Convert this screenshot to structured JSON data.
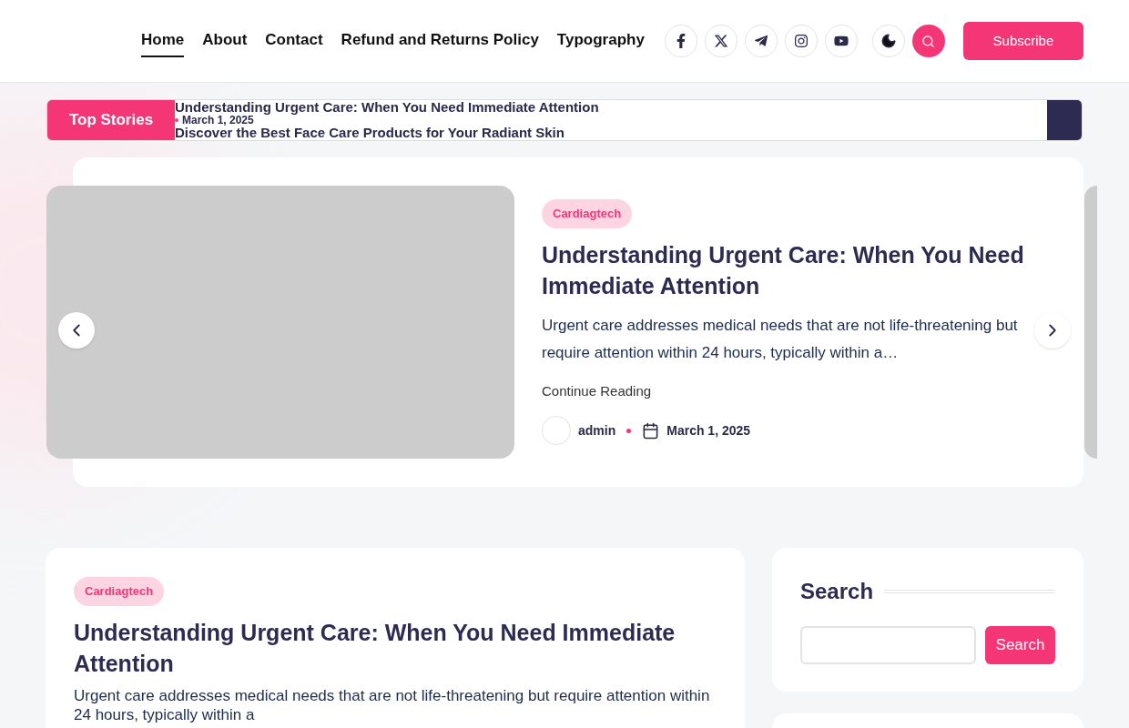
{
  "nav": {
    "items": [
      {
        "label": "Home",
        "selected": true
      },
      {
        "label": "About",
        "selected": false
      },
      {
        "label": "Contact",
        "selected": false
      },
      {
        "label": "Refund and Returns Policy",
        "selected": false
      },
      {
        "label": "Typography",
        "selected": false
      }
    ]
  },
  "social": [
    {
      "kind": "facebook"
    },
    {
      "kind": "x"
    },
    {
      "kind": "telegram"
    },
    {
      "kind": "instagram"
    },
    {
      "kind": "youtube"
    }
  ],
  "subscribe": "Subscribe",
  "ticker": {
    "label": "Top Stories",
    "items": [
      {
        "title": "Understanding Urgent Care: When You Need Immediate Attention",
        "date": "March 1, 2025"
      },
      {
        "title": "Discover the Best Face Care Products for Your Radiant Skin"
      }
    ]
  },
  "featured": {
    "category": "Cardiagtech",
    "title": "Understanding Urgent Care: When You Need Immediate Attention",
    "excerpt": "Urgent care addresses medical needs that are not life-threatening but require attention within 24 hours, typically within a…",
    "link": "Continue Reading",
    "author": "admin",
    "date": "March 1, 2025"
  },
  "post": {
    "category": "Cardiagtech",
    "title": "Understanding Urgent Care: When You Need Immediate Attention",
    "excerpt": "Urgent care addresses medical needs that are not life-threatening but require attention within 24 hours, typically within a"
  },
  "search_widget": {
    "title": "Search",
    "button": "Search"
  }
}
